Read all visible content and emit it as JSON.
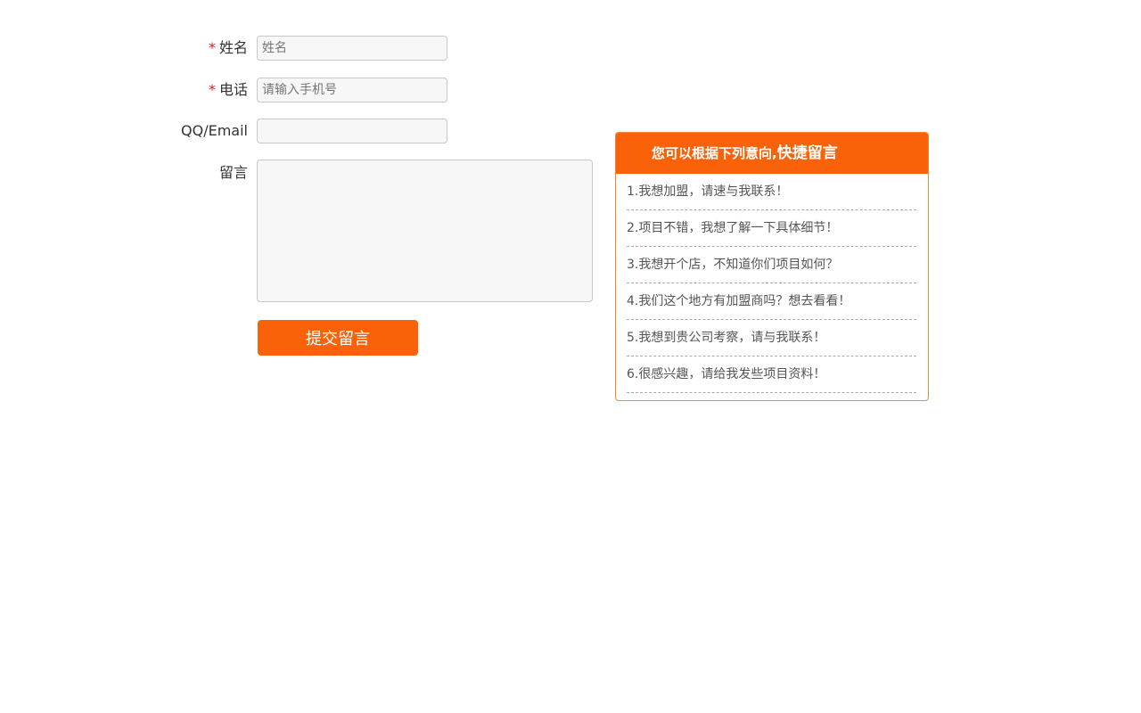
{
  "form": {
    "name": {
      "required_mark": "*",
      "label": "姓名",
      "placeholder": "姓名",
      "value": ""
    },
    "phone": {
      "required_mark": "*",
      "label": "电话",
      "placeholder": "请输入手机号",
      "value": ""
    },
    "contact": {
      "label": "QQ/Email",
      "placeholder": "",
      "value": ""
    },
    "message": {
      "label": "留言",
      "value": ""
    },
    "submit_label": "提交留言"
  },
  "quick_panel": {
    "title_small": "您可以根据下列意向,",
    "title_big": "快捷留言",
    "items": [
      "1.我想加盟，请速与我联系！",
      "2.项目不错，我想了解一下具体细节！",
      "3.我想开个店，不知道你们项目如何？",
      "4.我们这个地方有加盟商吗？想去看看！",
      "5.我想到贵公司考察，请与我联系！",
      "6.很感兴趣，请给我发些项目资料！"
    ]
  },
  "colors": {
    "accent": "#fa6209",
    "required": "#e02020",
    "panel_border": "#f08a3c",
    "input_bg": "#f8f7f8"
  }
}
